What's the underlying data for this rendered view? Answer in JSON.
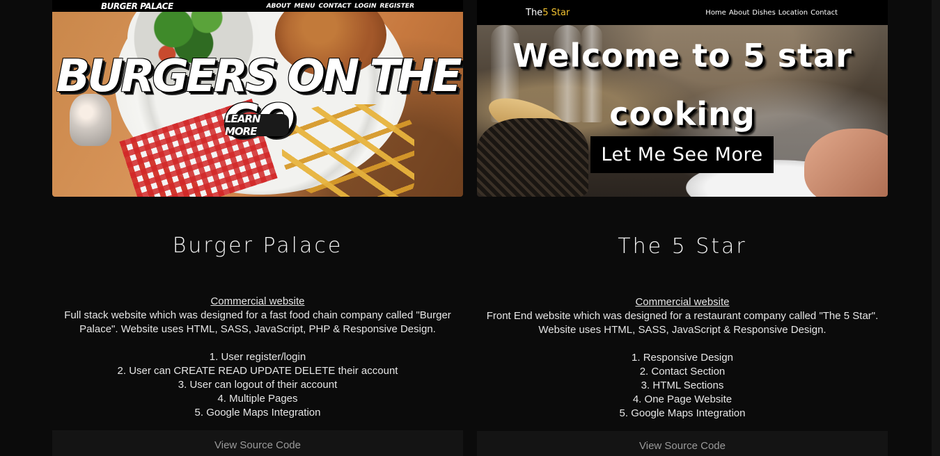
{
  "projects": [
    {
      "preview": {
        "logo": "BURGER PALACE",
        "nav": [
          "ABOUT",
          "MENU",
          "CONTACT",
          "LOGIN",
          "REGISTER"
        ],
        "headline": "BURGERS ON THE GO",
        "cta": "LEARN MORE"
      },
      "title": "Burger Palace",
      "kind": "Commercial website",
      "description": "Full stack website which was designed for a fast food chain company called \"Burger Palace\". Website uses HTML, SASS, JavaScript, PHP & Responsive Design.",
      "features": [
        "1. User register/login",
        "2. User can CREATE READ UPDATE DELETE their account",
        "3. User can logout of their account",
        "4. Multiple Pages",
        "5. Google Maps Integration"
      ],
      "source_label": "View Source Code"
    },
    {
      "preview": {
        "logo_prefix": "The",
        "logo_accent": "5 Star",
        "nav": [
          "Home",
          "About",
          "Dishes",
          "Location",
          "Contact"
        ],
        "headline_line1": "Welcome to 5 star",
        "headline_line2": "cooking",
        "cta": "Let Me See More"
      },
      "title": "The 5 Star",
      "kind": "Commercial website",
      "description": "Front End website which was designed for a restaurant company called \"The 5 Star\". Website uses HTML, SASS, JavaScript & Responsive Design.",
      "features": [
        "1. Responsive Design",
        "2. Contact Section",
        "3. HTML Sections",
        "4. One Page Website",
        "5. Google Maps Integration"
      ],
      "source_label": "View Source Code"
    }
  ],
  "colors": {
    "background": "#0b0b0b",
    "button_bg": "#141414",
    "accent_gold": "#f2c230"
  }
}
